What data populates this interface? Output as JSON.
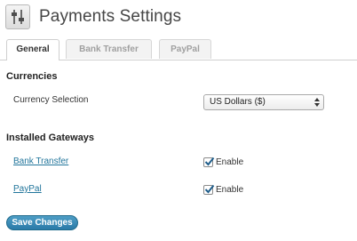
{
  "header": {
    "title": "Payments Settings",
    "icon": "settings-sliders-icon"
  },
  "tabs": [
    {
      "label": "General",
      "active": true
    },
    {
      "label": "Bank Transfer",
      "active": false
    },
    {
      "label": "PayPal",
      "active": false
    }
  ],
  "currencies": {
    "section_title": "Currencies",
    "currency_selection_label": "Currency Selection",
    "currency_selected": "US Dollars ($)"
  },
  "gateways": {
    "section_title": "Installed Gateways",
    "items": [
      {
        "name": "Bank Transfer",
        "enable_label": "Enable",
        "enabled": true
      },
      {
        "name": "PayPal",
        "enable_label": "Enable",
        "enabled": true
      }
    ]
  },
  "actions": {
    "save_label": "Save Changes"
  },
  "colors": {
    "link": "#21759b",
    "button": "#2a7aa8",
    "checkmark": "#1e5d8a"
  }
}
